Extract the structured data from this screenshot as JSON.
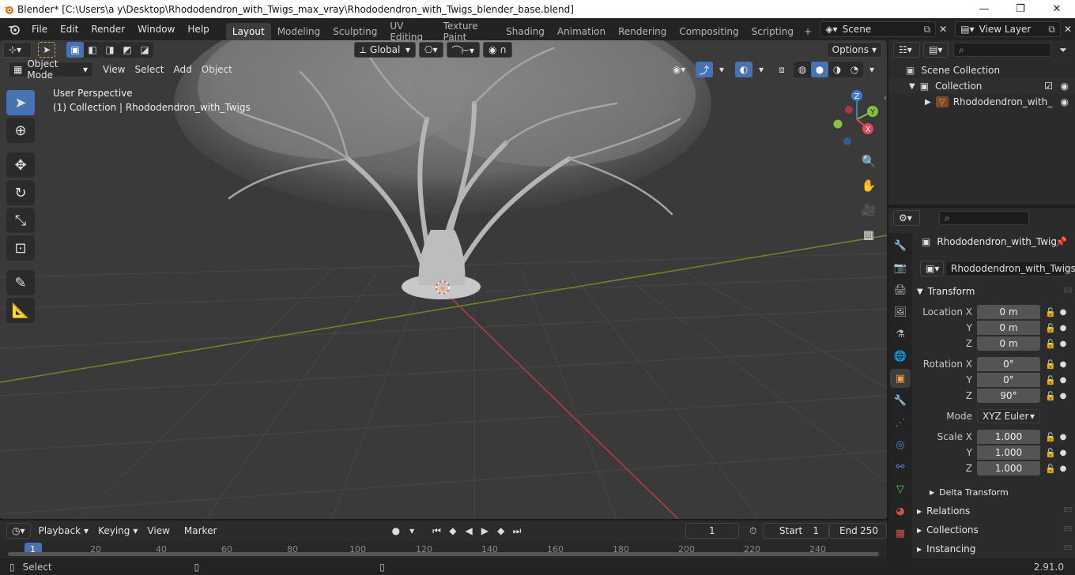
{
  "window": {
    "title": "Blender* [C:\\Users\\a y\\Desktop\\Rhododendron_with_Twigs_max_vray\\Rhododendron_with_Twigs_blender_base.blend]",
    "controls": [
      "—",
      "❐",
      "✕"
    ]
  },
  "menu": {
    "items": [
      "File",
      "Edit",
      "Render",
      "Window",
      "Help"
    ],
    "workspaces": [
      "Layout",
      "Modeling",
      "Sculpting",
      "UV Editing",
      "Texture Paint",
      "Shading",
      "Animation",
      "Rendering",
      "Compositing",
      "Scripting"
    ],
    "active_workspace": "Layout",
    "add_tab": "+",
    "scene": "Scene",
    "view_layer": "View Layer"
  },
  "viewport": {
    "mode": "Object Mode",
    "menus": [
      "View",
      "Select",
      "Add",
      "Object"
    ],
    "orientation": "Global",
    "options": "Options",
    "perspective": "User Perspective",
    "collection_info": "(1) Collection | Rhododendron_with_Twigs",
    "gizmo_axes": {
      "x": "X",
      "y": "Y",
      "z": "Z"
    }
  },
  "timeline": {
    "menus": [
      "Playback",
      "Keying",
      "View",
      "Marker"
    ],
    "current_frame": "1",
    "start_label": "Start",
    "start": "1",
    "end_label": "End",
    "end": "250",
    "ticks": [
      "1",
      "20",
      "40",
      "60",
      "80",
      "100",
      "120",
      "140",
      "160",
      "180",
      "200",
      "220",
      "240"
    ]
  },
  "outliner": {
    "scene_collection": "Scene Collection",
    "collection": "Collection",
    "object": "Rhododendron_with_"
  },
  "properties": {
    "object_name": "Rhododendron_with_Twig",
    "data_name": "Rhododendron_with_Twigs",
    "transform_label": "Transform",
    "location_label": "Location X",
    "location": [
      "0 m",
      "0 m",
      "0 m"
    ],
    "rotation_label": "Rotation X",
    "rotation": [
      "0°",
      "0°",
      "90°"
    ],
    "mode_label": "Mode",
    "mode_value": "XYZ Euler",
    "scale_label": "Scale X",
    "scale": [
      "1.000",
      "1.000",
      "1.000"
    ],
    "axis_y": "Y",
    "axis_z": "Z",
    "delta_transform": "Delta Transform",
    "relations": "Relations",
    "collections": "Collections",
    "instancing": "Instancing"
  },
  "status": {
    "select": "Select",
    "version": "2.91.0"
  },
  "colors": {
    "accent": "#4772b3",
    "axis_x": "#e04a5a",
    "axis_y": "#8bbe3c",
    "axis_z": "#3d7ad8",
    "object_orange": "#f0a23a"
  }
}
